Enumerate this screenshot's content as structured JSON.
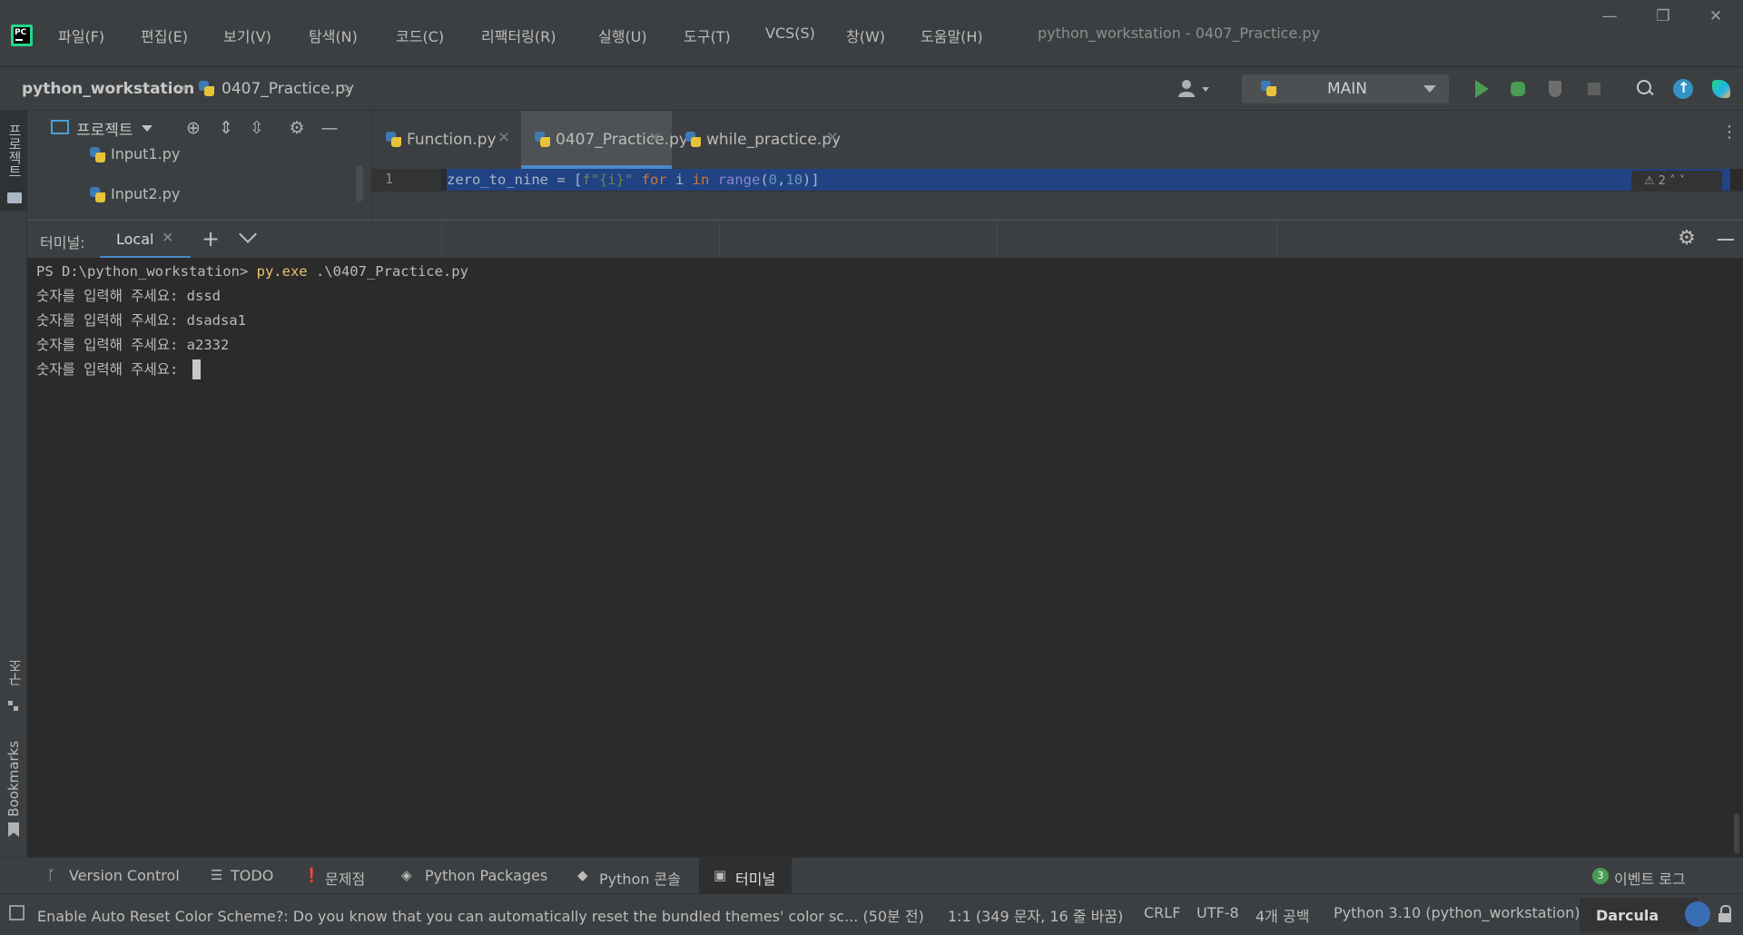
{
  "menu": {
    "items": [
      "파일(F)",
      "편집(E)",
      "보기(V)",
      "탐색(N)",
      "코드(C)",
      "리팩터링(R)",
      "실행(U)",
      "도구(T)",
      "VCS(S)",
      "창(W)",
      "도움말(H)"
    ],
    "window_title": "python_workstation - 0407_Practice.py",
    "logo_text": "PC"
  },
  "window_controls": {
    "minimize": "—",
    "restore": "❐",
    "close": "✕"
  },
  "breadcrumb": {
    "project": "python_workstation",
    "file": "0407_Practice.py",
    "separator": ">"
  },
  "toolbar": {
    "run_config": "MAIN"
  },
  "left_strip": {
    "project": "프로젝트",
    "structure": "구조",
    "bookmarks": "Bookmarks"
  },
  "project_panel": {
    "view_label": "프로젝트",
    "files": [
      "Input1.py",
      "Input2.py"
    ]
  },
  "editor": {
    "tabs": [
      {
        "label": "Function.py",
        "active": false
      },
      {
        "label": "0407_Practice.py",
        "active": true
      },
      {
        "label": "while_practice.py",
        "active": false
      }
    ],
    "line_number": "1",
    "code": {
      "var": "zero_to_nine",
      "eq": " = [",
      "fstr": "f\"{i}\"",
      "for_kw": " for ",
      "loop_var": "i",
      "in_kw": " in ",
      "fn": "range",
      "open": "(",
      "a": "0",
      "comma": ",",
      "b": "10",
      "close": ")]"
    },
    "inspection": "⚠ 2  ˄  ˅"
  },
  "terminal": {
    "title": "터미널:",
    "tab_label": "Local",
    "prompt": "PS D:\\python_workstation> ",
    "command": "py.exe",
    "command_args": " .\\0407_Practice.py",
    "lines": [
      {
        "prompt": "숫자를 입력해 주세요: ",
        "input": "dssd"
      },
      {
        "prompt": "숫자를 입력해 주세요: ",
        "input": "dsadsa1"
      },
      {
        "prompt": "숫자를 입력해 주세요: ",
        "input": "a2332"
      },
      {
        "prompt": "숫자를 입력해 주세요: ",
        "input": ""
      }
    ]
  },
  "tool_windows": {
    "version_control": "Version Control",
    "todo": "TODO",
    "problems": "문제점",
    "python_packages": "Python Packages",
    "python_console": "Python 콘솔",
    "terminal": "터미널",
    "event_log": "이벤트 로그",
    "event_log_count": "3"
  },
  "statusbar": {
    "message": "Enable Auto Reset Color Scheme?: Do you know that you can automatically reset the bundled themes' color sc... (50분 전)",
    "position": "1:1 (349 문자, 16 줄 바꿈)",
    "line_separator": "CRLF",
    "encoding": "UTF-8",
    "indent": "4개 공백",
    "interpreter": "Python 3.10 (python_workstation)",
    "theme": "Darcula"
  },
  "colors": {
    "background": "#2b2b2b",
    "panel": "#3c3f41",
    "selection": "#214283",
    "accent": "#4a88c7",
    "run_green": "#499c54",
    "command_yellow": "#e8c46a"
  }
}
